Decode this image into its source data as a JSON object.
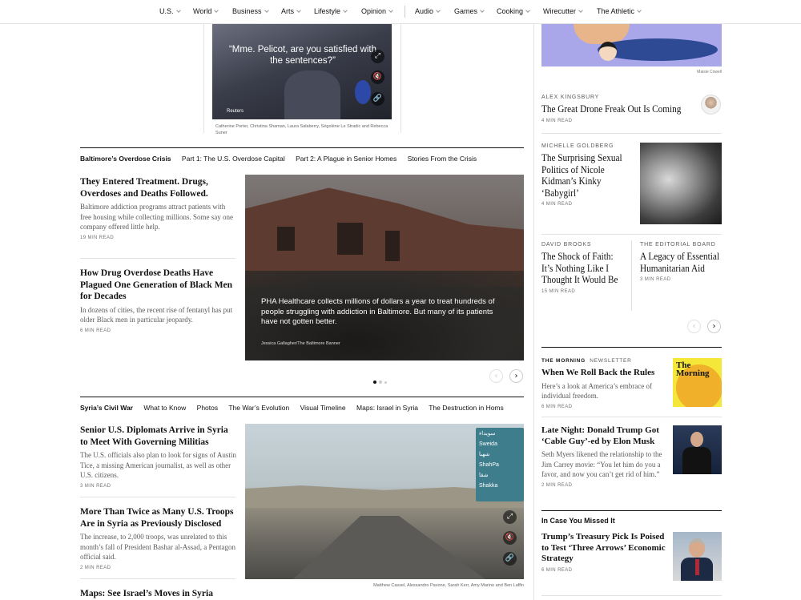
{
  "nav": {
    "items": [
      "U.S.",
      "World",
      "Business",
      "Arts",
      "Lifestyle",
      "Opinion",
      "Audio",
      "Games",
      "Cooking",
      "Wirecutter",
      "The Athletic"
    ]
  },
  "top_video": {
    "caption": "“Mme. Pelicot, are you satisfied with the sentences?”",
    "credit": "Reuters",
    "byline": "Catherine Porter, Christina Shaman, Laura Salaberry, Ségolène Le Stradic and Rebecca Suner",
    "expand_icon": "expand-icon",
    "mute_icon": "speaker-mute-icon",
    "link_icon": "link-icon"
  },
  "baltimore": {
    "section_title": "Baltimore’s Overdose Crisis",
    "links": [
      "Part 1: The U.S. Overdose Capital",
      "Part 2: A Plague in Senior Homes",
      "Stories From the Crisis"
    ],
    "stories": [
      {
        "headline": "They Entered Treatment. Drugs, Overdoses and Deaths Followed.",
        "summary": "Baltimore addiction programs attract patients with free housing while collecting millions. Some say one company offered little help.",
        "read": "19 MIN READ"
      },
      {
        "headline": "How Drug Overdose Deaths Have Plagued One Generation of Black Men for Decades",
        "summary": "In dozens of cities, the recent rise of fentanyl has put older Black men in particular jeopardy.",
        "read": "6 MIN READ"
      }
    ],
    "image_caption": "PHA Healthcare collects millions of dollars a year to treat hundreds of people struggling with addiction in Baltimore. But many of its patients have not gotten better.",
    "image_credit": "Jessica Gallagher/The Baltimore Banner"
  },
  "syria": {
    "section_title": "Syria’s Civil War",
    "links": [
      "What to Know",
      "Photos",
      "The War’s Evolution",
      "Visual Timeline",
      "Maps: Israel in Syria",
      "The Destruction in Homs"
    ],
    "stories": [
      {
        "headline": "Senior U.S. Diplomats Arrive in Syria to Meet With Governing Militias",
        "summary": "The U.S. officials also plan to look for signs of Austin Tice, a missing American journalist, as well as other U.S. citizens.",
        "read": "3 MIN READ"
      },
      {
        "headline": "More Than Twice as Many U.S. Troops Are in Syria as Previously Disclosed",
        "summary": "The increase, to 2,000 troops, was unrelated to this month’s fall of President Bashar al-Assad, a Pentagon official said.",
        "read": "2 MIN READ"
      },
      {
        "headline": "Maps: See Israel’s Moves in Syria Since"
      }
    ],
    "sign_lines": [
      "سويداء",
      "Sweida",
      "شهبا",
      "ShahPa",
      "شقا",
      "Shakka"
    ],
    "image_credit": "Matthew Cassel, Alessandro Pavone, Sarah Kerr, Amy Marino and Ben Laffin"
  },
  "opinion": {
    "illus_credit": "Maisie Cowell",
    "items": [
      {
        "author": "ALEX KINGSBURY",
        "headline": "The Great Drone Freak Out Is Coming",
        "read": "4 MIN READ"
      },
      {
        "author": "MICHELLE GOLDBERG",
        "headline": "The Surprising Sexual Politics of Nicole Kidman’s Kinky ‘Babygirl’",
        "read": "4 MIN READ"
      },
      {
        "author": "DAVID BROOKS",
        "headline": "The Shock of Faith: It’s Nothing Like I Thought It Would Be",
        "read": "15 MIN READ"
      },
      {
        "author": "THE EDITORIAL BOARD",
        "headline": "A Legacy of Essential Humanitarian Aid",
        "read": "3 MIN READ"
      }
    ]
  },
  "morning": {
    "kicker_a": "THE MORNING",
    "kicker_b": "NEWSLETTER",
    "headline": "When We Roll Back the Rules",
    "summary": "Here’s a look at America’s embrace of individual freedom.",
    "read": "6 MIN READ",
    "logo_text": "The Morning"
  },
  "late_night": {
    "headline": "Late Night: Donald Trump Got ‘Cable Guy’-ed by Elon Musk",
    "summary": "Seth Myers likened the relationship to the Jim Carrey movie: “You let him do you a favor, and now you can’t get rid of him.”",
    "read": "2 MIN READ"
  },
  "missed": {
    "section_title": "In Case You Missed It",
    "headline": "Trump’s Treasury Pick Is Poised to Test ‘Three Arrows’ Economic Strategy",
    "read": "6 MIN READ"
  },
  "carousel": {
    "prev_icon": "chevron-left-icon",
    "next_icon": "chevron-right-icon"
  }
}
